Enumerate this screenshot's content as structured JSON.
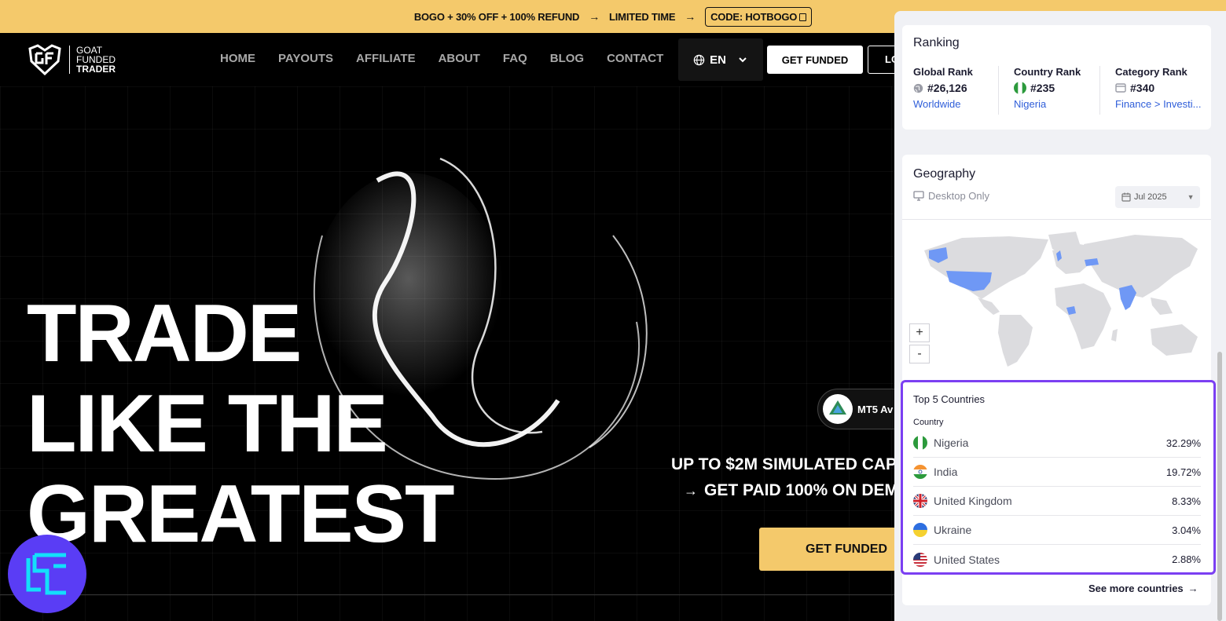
{
  "promo": {
    "offer": "BOGO + 30% OFF + 100% REFUND",
    "arrow1": "→",
    "limited": "LIMITED TIME",
    "arrow2": "→",
    "code": "CODE: HOTBOGO"
  },
  "nav": {
    "logo_lines": [
      "GOAT",
      "FUNDED",
      "TRADER"
    ],
    "items": [
      "HOME",
      "PAYOUTS",
      "AFFILIATE",
      "ABOUT",
      "FAQ",
      "BLOG",
      "CONTACT"
    ],
    "language": "EN",
    "cta": "GET FUNDED",
    "login": "LO"
  },
  "hero": {
    "headline": [
      "TRADE",
      "LIKE THE",
      "GREATEST"
    ],
    "platform_badge": "MT5 Av",
    "platform_logo": "MetaTrader 5",
    "subline1": "UP TO $2M SIMULATED CAP",
    "subline2": "GET PAID 100% ON DEM",
    "cta": "GET FUNDED"
  },
  "ranking": {
    "title": "Ranking",
    "columns": [
      {
        "label": "Global Rank",
        "value": "#26,126",
        "link": "Worldwide",
        "icon": "globe-icon"
      },
      {
        "label": "Country Rank",
        "value": "#235",
        "link": "Nigeria",
        "icon": "nigeria-flag-icon"
      },
      {
        "label": "Category Rank",
        "value": "#340",
        "link": "Finance > Investi...",
        "icon": "category-icon"
      }
    ]
  },
  "geography": {
    "title": "Geography",
    "device": "Desktop Only",
    "date": "Jul 2025",
    "zoom_in": "+",
    "zoom_out": "-",
    "highlight_color": "#6f98f5",
    "land_color": "#dcdcdf"
  },
  "top_countries": {
    "title": "Top 5 Countries",
    "column_header": "Country",
    "rows": [
      {
        "name": "Nigeria",
        "pct": "32.29%"
      },
      {
        "name": "India",
        "pct": "19.72%"
      },
      {
        "name": "United Kingdom",
        "pct": "8.33%"
      },
      {
        "name": "Ukraine",
        "pct": "3.04%"
      },
      {
        "name": "United States",
        "pct": "2.88%"
      }
    ],
    "see_more": "See more countries",
    "see_more_arrow": "→"
  }
}
